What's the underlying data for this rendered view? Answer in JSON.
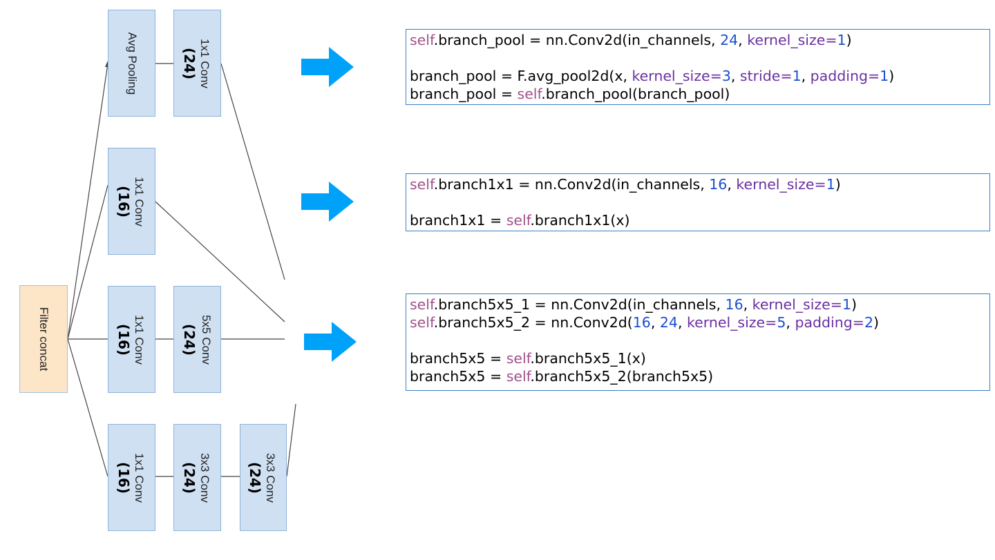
{
  "diagram": {
    "filter_concat": "Filter concat",
    "pool_branch": {
      "pool_label": "Avg Pooling",
      "conv_label": "1x1 Conv",
      "conv_channels": "(24)"
    },
    "branch1x1": {
      "conv_label": "1x1 Conv",
      "conv_channels": "(16)"
    },
    "branch5x5": {
      "conv1_label": "1x1 Conv",
      "conv1_channels": "(16)",
      "conv2_label": "5x5 Conv",
      "conv2_channels": "(24)"
    },
    "branch3x3": {
      "conv1_label": "1x1 Conv",
      "conv1_channels": "(16)",
      "conv2_label": "3x3 Conv",
      "conv2_channels": "(24)",
      "conv3_label": "3x3 Conv",
      "conv3_channels": "(24)"
    }
  },
  "colors": {
    "arrow": "#00a2f9",
    "code_border": "#3a7dbf",
    "self": "#a2508c",
    "number": "#1a4fd0",
    "argument": "#6b2fa0",
    "conv_fill": "#cfe0f3",
    "concat_fill": "#fde5c8"
  },
  "code": {
    "pool": {
      "l1": {
        "a": "self",
        "b": ".branch_pool = nn.Conv2d(in_channels, ",
        "c": "24",
        "d": ", ",
        "e": "kernel_size",
        "f": "=",
        "g": "1",
        "h": ")"
      },
      "l3": {
        "a": "branch_pool = F.avg_pool2d(x, ",
        "b": "kernel_size",
        "c": "=",
        "d": "3",
        "e": ", ",
        "f": "stride",
        "g": "=",
        "h": "1",
        "i": ", ",
        "j": "padding",
        "k": "=",
        "l": "1",
        "m": ")"
      },
      "l4": {
        "a": "branch_pool = ",
        "b": "self",
        "c": ".branch_pool(branch_pool)"
      }
    },
    "b1x1": {
      "l1": {
        "a": "self",
        "b": ".branch1x1 = nn.Conv2d(in_channels, ",
        "c": "16",
        "d": ", ",
        "e": "kernel_size",
        "f": "=",
        "g": "1",
        "h": ")"
      },
      "l3": {
        "a": "branch1x1 = ",
        "b": "self",
        "c": ".branch1x1(x)"
      }
    },
    "b5x5": {
      "l1": {
        "a": "self",
        "b": ".branch5x5_1 = nn.Conv2d(in_channels, ",
        "c": "16",
        "d": ", ",
        "e": "kernel_size",
        "f": "=",
        "g": "1",
        "h": ")"
      },
      "l2": {
        "a": "self",
        "b": ".branch5x5_2 = nn.Conv2d(",
        "c": "16",
        "d": ", ",
        "e": "24",
        "f": ", ",
        "g": "kernel_size",
        "h": "=",
        "i": "5",
        "j": ", ",
        "k": "padding",
        "l": "=",
        "m": "2",
        "n": ")"
      },
      "l4": {
        "a": "branch5x5 = ",
        "b": "self",
        "c": ".branch5x5_1(x)"
      },
      "l5": {
        "a": "branch5x5 = ",
        "b": "self",
        "c": ".branch5x5_2(branch5x5)"
      }
    }
  }
}
